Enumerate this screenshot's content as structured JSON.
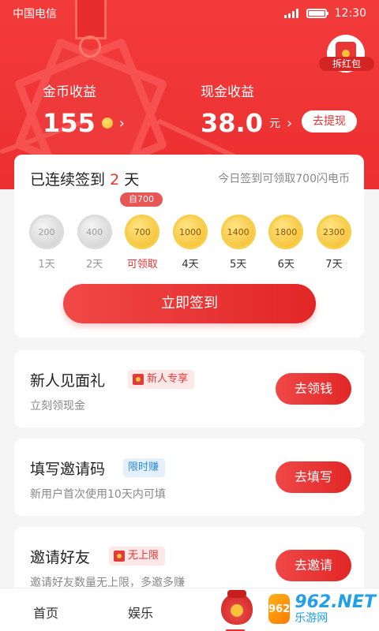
{
  "status_bar": {
    "carrier": "中国电信",
    "time": "12:30"
  },
  "hongbao": {
    "label": "拆红包"
  },
  "gold_income": {
    "label": "金币收益",
    "value": "155",
    "chevron": "›"
  },
  "cash_income": {
    "label": "现金收益",
    "value": "38.0",
    "unit": "元",
    "chevron": "›",
    "withdraw_label": "去提现"
  },
  "signin": {
    "title_prefix": "已连续签到",
    "days": "2",
    "title_suffix": "天",
    "hint": "今日签到可领取700闪电币",
    "today_tag": "自700",
    "coins": [
      {
        "amount": "200",
        "day": "1天",
        "state": "done"
      },
      {
        "amount": "400",
        "day": "2天",
        "state": "done"
      },
      {
        "amount": "700",
        "day": "可领取",
        "state": "today"
      },
      {
        "amount": "1000",
        "day": "4天",
        "state": "future"
      },
      {
        "amount": "1400",
        "day": "5天",
        "state": "future"
      },
      {
        "amount": "1800",
        "day": "6天",
        "state": "future"
      },
      {
        "amount": "2300",
        "day": "7天",
        "state": "future"
      }
    ],
    "button_label": "立即签到"
  },
  "tasks": [
    {
      "title": "新人见面礼",
      "tag": "新人专享",
      "sub": "立刻领现金",
      "button": "去领钱"
    },
    {
      "title": "填写邀请码",
      "tag": "限时赚",
      "sub": "新用户首次使用10天内可填",
      "button": "去填写"
    },
    {
      "title": "邀请好友",
      "tag": "无上限",
      "sub": "邀请好友数量无上限，多邀多赚",
      "button": "去邀请"
    }
  ],
  "tabbar": {
    "home": "首页",
    "entertainment": "娱乐"
  },
  "watermark": {
    "badge": "962",
    "main": "962.NET",
    "sub": "乐游网"
  },
  "colors": {
    "primary": "#e53333",
    "hero": "#f03838",
    "gold": "#f3b41b",
    "tag_blue": "#2d8ae0"
  }
}
